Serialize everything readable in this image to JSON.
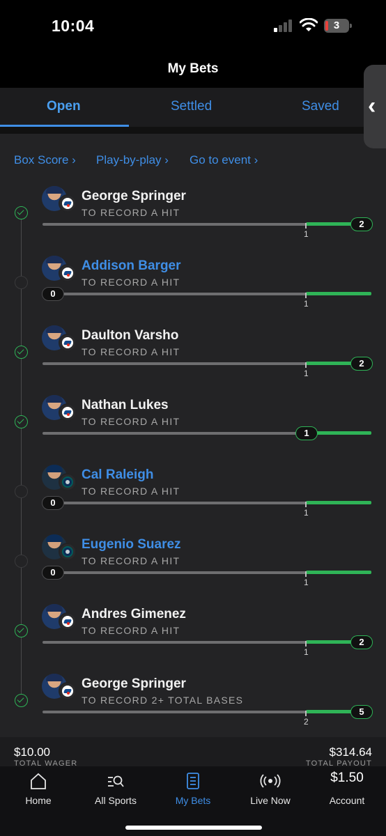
{
  "status_bar": {
    "time": "10:04",
    "battery": "3"
  },
  "header": {
    "title": "My Bets"
  },
  "tabs": [
    {
      "label": "Open",
      "active": true
    },
    {
      "label": "Settled",
      "active": false
    },
    {
      "label": "Saved",
      "active": false
    }
  ],
  "links": [
    "Box Score",
    "Play-by-play",
    "Go to event"
  ],
  "legs": [
    {
      "player": "George Springer",
      "bet": "TO RECORD A HIT",
      "team": "blue-jays",
      "current": "2",
      "line": "1",
      "won": true,
      "name_link": false,
      "progress": 2
    },
    {
      "player": "Addison Barger",
      "bet": "TO RECORD A HIT",
      "team": "blue-jays",
      "current": "0",
      "line": "1",
      "won": false,
      "name_link": true,
      "progress": 0
    },
    {
      "player": "Daulton Varsho",
      "bet": "TO RECORD A HIT",
      "team": "blue-jays",
      "current": "2",
      "line": "1",
      "won": true,
      "name_link": false,
      "progress": 2
    },
    {
      "player": "Nathan Lukes",
      "bet": "TO RECORD A HIT",
      "team": "blue-jays",
      "current": "1",
      "line": "",
      "won": true,
      "name_link": false,
      "progress": 1
    },
    {
      "player": "Cal Raleigh",
      "bet": "TO RECORD A HIT",
      "team": "mariners",
      "current": "0",
      "line": "1",
      "won": false,
      "name_link": true,
      "progress": 0
    },
    {
      "player": "Eugenio Suarez",
      "bet": "TO RECORD A HIT",
      "team": "mariners",
      "current": "0",
      "line": "1",
      "won": false,
      "name_link": true,
      "progress": 0
    },
    {
      "player": "Andres Gimenez",
      "bet": "TO RECORD A HIT",
      "team": "blue-jays",
      "current": "2",
      "line": "1",
      "won": true,
      "name_link": false,
      "progress": 2
    },
    {
      "player": "George Springer",
      "bet": "TO RECORD 2+ TOTAL BASES",
      "team": "blue-jays",
      "current": "5",
      "line": "2",
      "won": true,
      "name_link": false,
      "progress": 5
    }
  ],
  "summary": {
    "wager": "$10.00",
    "wager_label": "TOTAL WAGER",
    "payout": "$314.64",
    "payout_label": "TOTAL PAYOUT"
  },
  "bottom_nav": [
    {
      "label": "Home",
      "icon": "home-icon",
      "active": false
    },
    {
      "label": "All Sports",
      "icon": "search-list-icon",
      "active": false
    },
    {
      "label": "My Bets",
      "icon": "betslip-icon",
      "active": true
    },
    {
      "label": "Live Now",
      "icon": "live-broadcast-icon",
      "active": false
    },
    {
      "label": "Account",
      "icon": "account-balance",
      "balance": "$1.50",
      "active": false
    }
  ],
  "colors": {
    "accent": "#3f8ee6",
    "win": "#2fb457",
    "background": "#232325"
  }
}
